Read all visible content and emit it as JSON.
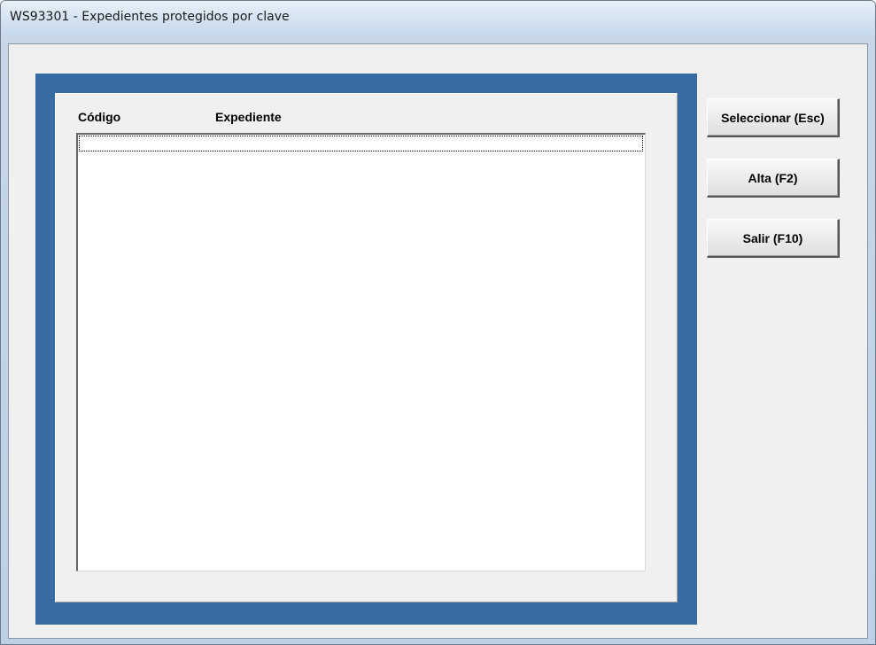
{
  "window": {
    "title": "WS93301 - Expedientes protegidos por clave"
  },
  "list": {
    "columns": [
      "Código",
      "Expediente"
    ],
    "rows": []
  },
  "buttons": {
    "select_label": "Seleccionar (Esc)",
    "alta_label": "Alta (F2)",
    "salir_label": "Salir (F10)"
  },
  "colors": {
    "frame_accent": "#386aa4",
    "panel_bg": "#f0f0f0",
    "list_bg": "#ffffff"
  }
}
